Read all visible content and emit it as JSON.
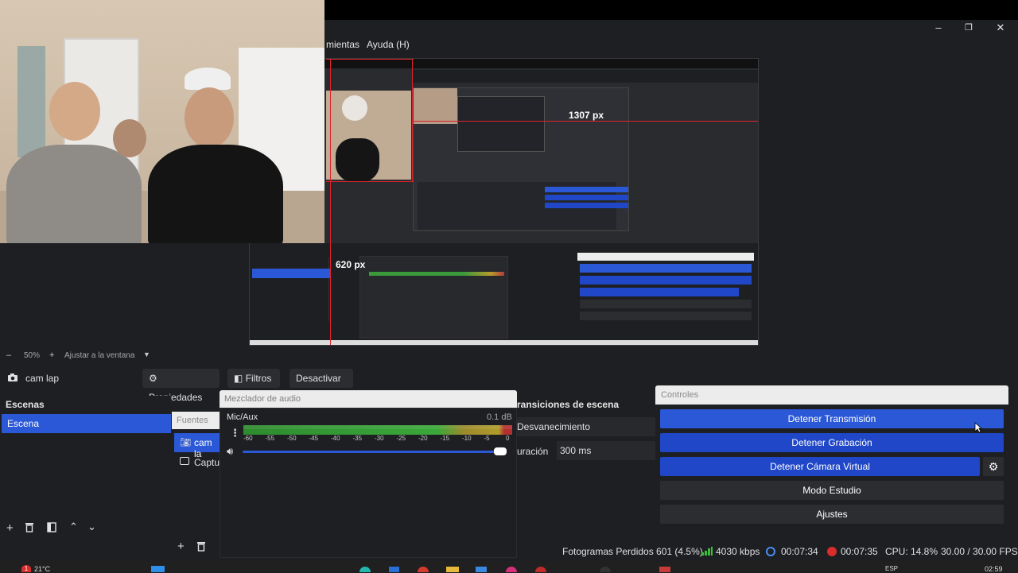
{
  "window": {
    "minimize": "–",
    "maximize": "❐",
    "close": "✕"
  },
  "menu": {
    "tools": "mientas",
    "help": "Ayuda (H)"
  },
  "preview": {
    "measure_width": "1307 px",
    "measure_height": "620 px",
    "zoom": "50%",
    "zoom_out": "–",
    "zoom_in": "+",
    "fit": "Ajustar a la ventana"
  },
  "source_bar": {
    "source_name": "cam lap",
    "properties": "Propiedades",
    "filters": "Filtros",
    "deactivate": "Desactivar"
  },
  "scenes": {
    "title": "Escenas",
    "items": [
      "Escena"
    ]
  },
  "sources": {
    "title": "Fuentes",
    "items": [
      "cam la",
      "Captur"
    ]
  },
  "mixer": {
    "title": "Mezclador de audio",
    "channel": "Mic/Aux",
    "db": "0.1 dB",
    "ticks": [
      "-60",
      "-55",
      "-50",
      "-45",
      "-40",
      "-35",
      "-30",
      "-25",
      "-20",
      "-15",
      "-10",
      "-5",
      "0"
    ],
    "volume_level": 1.0
  },
  "transitions": {
    "title": "ransiciones de escena",
    "type": "Desvanecimiento",
    "duration_label": "uración",
    "duration": "300 ms"
  },
  "controls": {
    "title": "Controles",
    "stop_stream": "Detener Transmisión",
    "stop_record": "Detener Grabación",
    "stop_vcam": "Detener Cámara Virtual",
    "studio": "Modo Estudio",
    "settings": "Ajustes"
  },
  "status": {
    "dropped": "Fotogramas Perdidos 601 (4.5%)",
    "bitrate": "4030 kbps",
    "stream_time": "00:07:34",
    "rec_time": "00:07:35",
    "cpu": "CPU: 14.8%",
    "fps": "30.00 / 30.00 FPS"
  },
  "taskbar": {
    "weather": "21°C",
    "lang": "ESP",
    "time": "02:59",
    "badge": "1"
  },
  "colors": {
    "accent": "#2b58d6",
    "accent_dark": "#1f47c8",
    "guide": "#e0232b"
  }
}
